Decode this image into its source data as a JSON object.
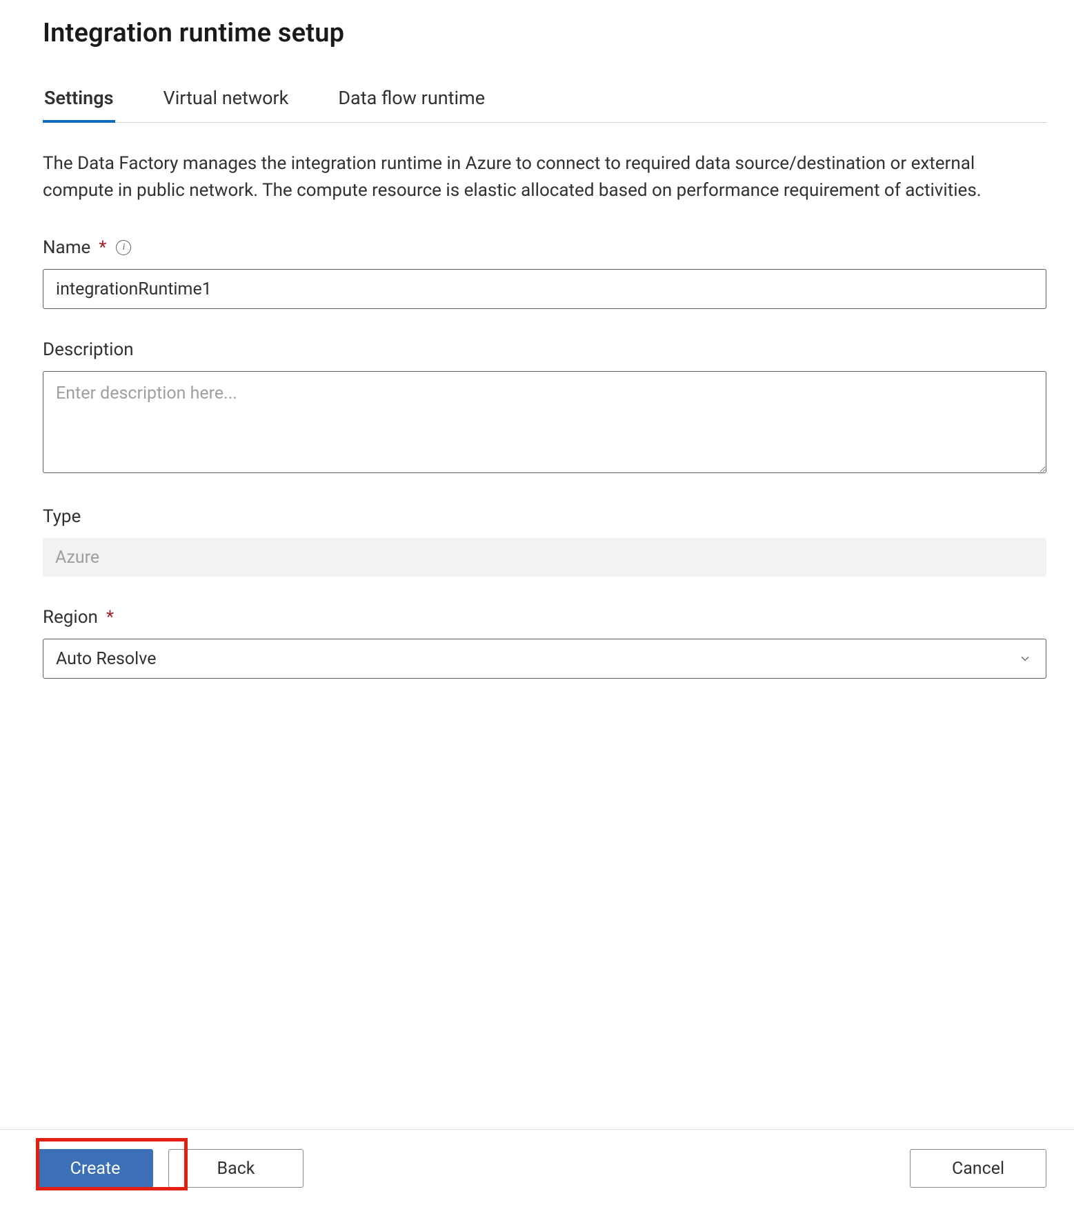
{
  "title": "Integration runtime setup",
  "tabs": {
    "settings": "Settings",
    "virtual_network": "Virtual network",
    "data_flow_runtime": "Data flow runtime",
    "active": "settings"
  },
  "intro": "The Data Factory manages the integration runtime in Azure to connect to required data source/destination or external compute in public network. The compute resource is elastic allocated based on performance requirement of activities.",
  "fields": {
    "name": {
      "label": "Name",
      "required_marker": "*",
      "value": "integrationRuntime1"
    },
    "description": {
      "label": "Description",
      "placeholder": "Enter description here...",
      "value": ""
    },
    "type": {
      "label": "Type",
      "value": "Azure"
    },
    "region": {
      "label": "Region",
      "required_marker": "*",
      "selected": "Auto Resolve"
    }
  },
  "buttons": {
    "create": "Create",
    "back": "Back",
    "cancel": "Cancel"
  }
}
